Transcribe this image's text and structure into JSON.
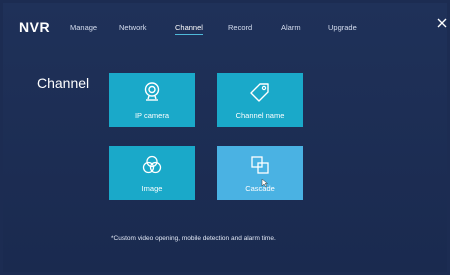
{
  "app": {
    "logo": "NVR"
  },
  "nav": {
    "tabs": [
      {
        "label": "Manage"
      },
      {
        "label": "Network"
      },
      {
        "label": "Channel"
      },
      {
        "label": "Record"
      },
      {
        "label": "Alarm"
      },
      {
        "label": "Upgrade"
      }
    ],
    "active_tab": "Channel"
  },
  "section": {
    "title": "Channel"
  },
  "tiles": [
    {
      "label": "IP camera",
      "icon": "webcam-icon"
    },
    {
      "label": "Channel name",
      "icon": "tag-icon"
    },
    {
      "label": "Image",
      "icon": "color-circles-icon"
    },
    {
      "label": "Cascade",
      "icon": "overlap-squares-icon",
      "selected": true
    }
  ],
  "footnote": "*Custom video opening, mobile detection and alarm time.",
  "colors": {
    "background": "#1c2c52",
    "tile": "#1aa9c9",
    "tile_selected": "#4ab2e3",
    "accent": "#4fb9d9"
  }
}
